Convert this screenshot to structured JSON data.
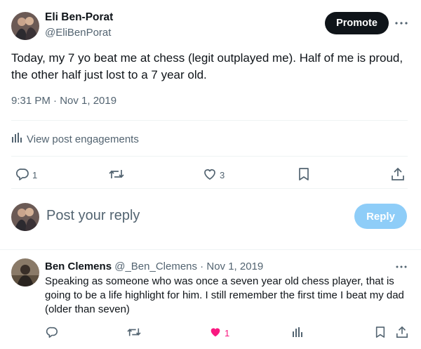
{
  "post": {
    "author_name": "Eli Ben-Porat",
    "author_handle": "@EliBenPorat",
    "promote_label": "Promote",
    "text": "Today, my 7 yo beat me at chess (legit outplayed me). Half of me is proud, the other half just lost to a 7 year old.",
    "timestamp": "9:31 PM · Nov 1, 2019",
    "engagements_label": "View post engagements",
    "reply_count": "1",
    "like_count": "3"
  },
  "composer": {
    "placeholder": "Post your reply",
    "reply_label": "Reply"
  },
  "reply": {
    "author_name": "Ben Clemens",
    "author_handle": "@_Ben_Clemens",
    "separator": " · ",
    "date": "Nov 1, 2019",
    "text": "Speaking as someone who was once a seven year old chess player, that is going to be a life highlight for him. I still remember the first time I beat my dad (older than seven)",
    "like_count": "1"
  },
  "icons": {
    "post_actions": [
      "reply-icon",
      "repost-icon",
      "like-icon",
      "bookmark-icon",
      "share-icon"
    ],
    "reply_actions": [
      "reply-icon",
      "repost-icon",
      "liked-heart-icon",
      "analytics-icon",
      "bookmark-icon",
      "share-icon"
    ]
  },
  "colors": {
    "text_primary": "#0f1419",
    "text_secondary": "#536471",
    "like_active": "#f91880",
    "reply_button_disabled": "#8ecdf8",
    "promote_button": "#0f1419"
  }
}
